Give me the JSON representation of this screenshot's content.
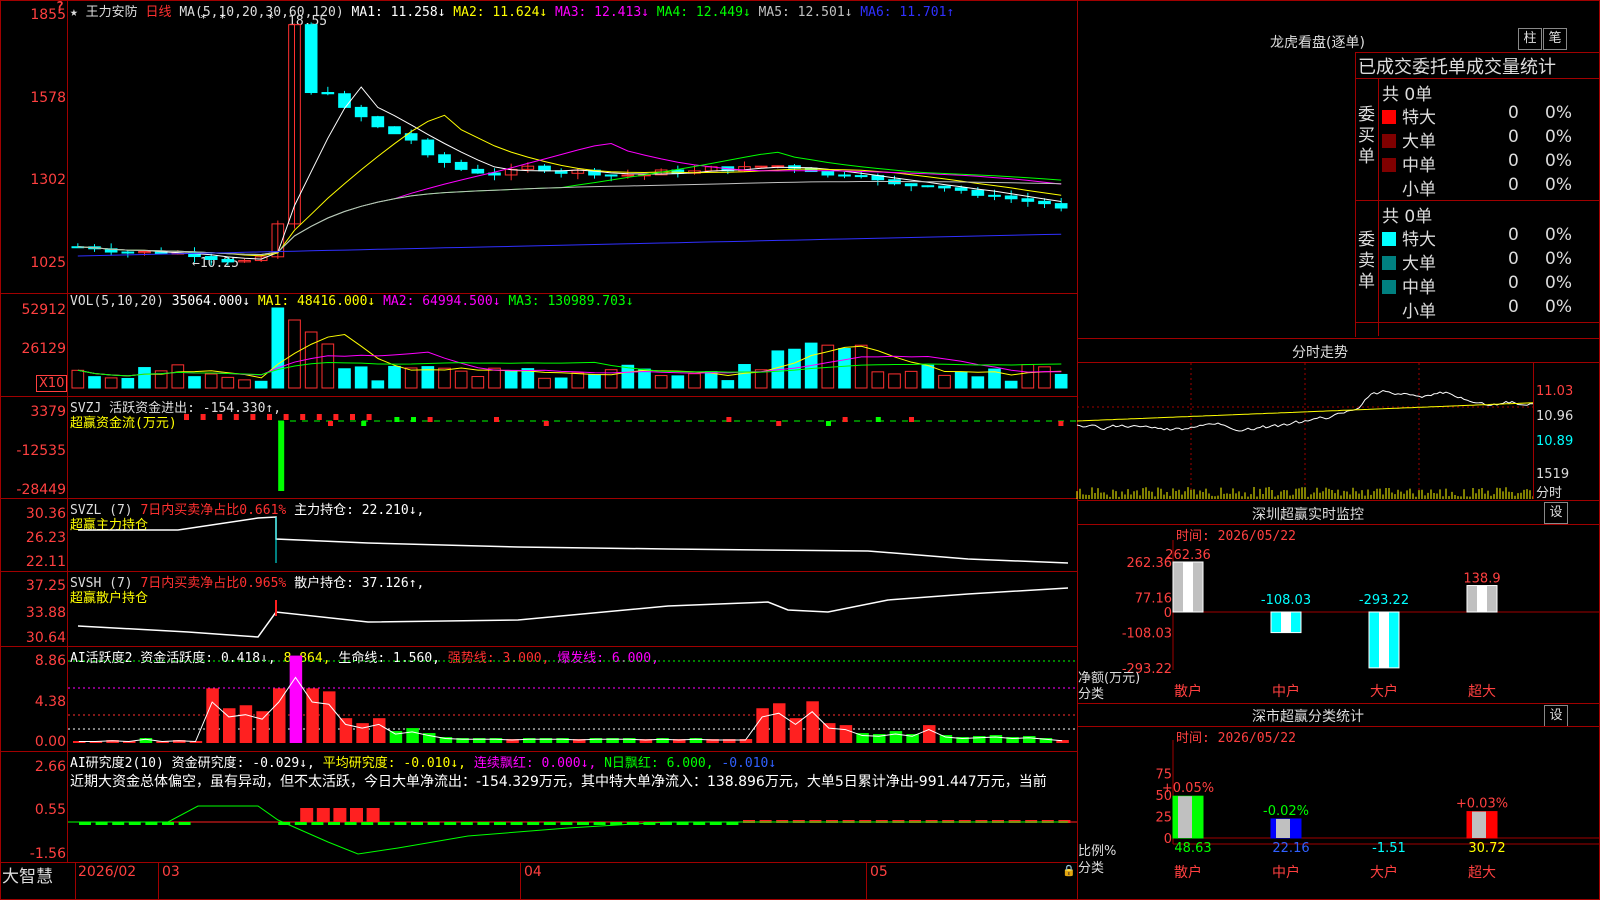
{
  "main": {
    "stock_name": "王力安防",
    "period": "日线",
    "ma_header": "MA(5,10,20,30,60,120)",
    "ma": [
      {
        "label": "MA1: 11.258↓",
        "color": "#ffffff"
      },
      {
        "label": "MA2: 11.624↓",
        "color": "#ffff00"
      },
      {
        "label": "MA3: 12.413↓",
        "color": "#ff00ff"
      },
      {
        "label": "MA4: 12.449↓",
        "color": "#00ff00"
      },
      {
        "label": "MA5: 12.501↓",
        "color": "#c0c0c0"
      },
      {
        "label": "MA6: 11.701↑",
        "color": "#3030ff"
      }
    ],
    "y_ticks": [
      "1855",
      "1578",
      "1302",
      "1025"
    ],
    "high_label": "18.55",
    "low_label": "←10.25",
    "question": "?"
  },
  "vol": {
    "header": "VOL(5,10,20)",
    "value": "35064.000↓",
    "ma": [
      {
        "label": "MA1: 48416.000↓",
        "color": "#ffff00"
      },
      {
        "label": "MA2: 64994.500↓",
        "color": "#ff00ff"
      },
      {
        "label": "MA3: 130989.703↓",
        "color": "#00ff00"
      }
    ],
    "y_ticks": [
      "52912",
      "26129"
    ],
    "unit": "X10"
  },
  "svzj": {
    "line1": "SVZJ  活跃资金进出: -154.330↑,",
    "line2": "超赢资金流(万元)",
    "y_ticks": [
      "3379",
      "-12535",
      "-28449"
    ]
  },
  "svzl": {
    "label_a": "SVZL (7)",
    "label_b": "7日内买卖净占比0.661%",
    "label_c": "主力持仓: 22.210↓,",
    "line2": "超赢主力持仓",
    "y_ticks": [
      "30.36",
      "26.23",
      "22.11"
    ]
  },
  "svsh": {
    "label_a": "SVSH (7)",
    "label_b": "7日内买卖净占比0.965%",
    "label_c": "散户持仓: 37.126↑,",
    "line2": "超赢散户持仓",
    "y_ticks": [
      "37.25",
      "33.88",
      "30.64"
    ]
  },
  "ai_act": {
    "label_a": "AI活跃度2 资金活跃度: 0.418↓,",
    "label_b": "8.864,",
    "label_c": "生命线: 1.560,",
    "label_d": "强势线: 3.000,",
    "label_e": "爆发线: 6.000,",
    "y_ticks": [
      "8.86",
      "4.38",
      "0.00"
    ]
  },
  "ai_res": {
    "label_a": "AI研究度2(10) 资金研究度: -0.029↓,",
    "label_b": "平均研究度: -0.010↓,",
    "label_c": "连续飘红: 0.000↓,",
    "label_d": "N日飘红: 6.000,",
    "label_e": "-0.010↓",
    "commentary": "近期大资金总体偏空，虽有异动，但不太活跃，今日大单净流出：-154.329万元，其中特大单净流入：138.896万元，大单5日累计净出-991.447万元，当前",
    "y_ticks": [
      "2.66",
      "0.55",
      "-1.56"
    ]
  },
  "footer": {
    "brand": "大智慧",
    "dates": [
      "2026/02",
      "03",
      "04",
      "05"
    ]
  },
  "right": {
    "lhb_title": "龙虎看盘(逐单)",
    "btn_zhu": "柱",
    "btn_bi": "笔",
    "stat_title": "已成交委托单成交量统计",
    "buy": {
      "side_label": "委买单",
      "total": "共 0单",
      "rows": [
        {
          "label": "特大",
          "count": "0",
          "pct": "0%",
          "color": "#ff0000"
        },
        {
          "label": "大单",
          "count": "0",
          "pct": "0%",
          "color": "#800000"
        },
        {
          "label": "中单",
          "count": "0",
          "pct": "0%",
          "color": "#800000"
        },
        {
          "label": "小单",
          "count": "0",
          "pct": "0%",
          "color": "#000000"
        }
      ]
    },
    "sell": {
      "side_label": "委卖单",
      "total": "共 0单",
      "rows": [
        {
          "label": "特大",
          "count": "0",
          "pct": "0%",
          "color": "#00ffff"
        },
        {
          "label": "大单",
          "count": "0",
          "pct": "0%",
          "color": "#008080"
        },
        {
          "label": "中单",
          "count": "0",
          "pct": "0%",
          "color": "#008080"
        },
        {
          "label": "小单",
          "count": "0",
          "pct": "0%",
          "color": "#000000"
        }
      ]
    },
    "intraday": {
      "title": "分时走势",
      "price_ticks": [
        "11.03",
        "10.96",
        "10.89"
      ],
      "vol_tick": "1519",
      "vol_unit": "分时"
    },
    "monitor": {
      "title": "深圳超赢实时监控",
      "btn": "设",
      "time": "时间: 2026/05/22",
      "y_ticks": [
        "262.36",
        "77.16",
        "0",
        "-108.03",
        "-293.22"
      ],
      "unit_a": "净额(万元)",
      "unit_b": "分类",
      "bars": [
        {
          "cat": "散户",
          "value": 262.36,
          "label": "262.36",
          "label_color": "#ff4040"
        },
        {
          "cat": "中户",
          "value": -108.03,
          "label": "-108.03",
          "label_color": "#00ffff"
        },
        {
          "cat": "大户",
          "value": -293.22,
          "label": "-293.22",
          "label_color": "#00ffff"
        },
        {
          "cat": "超大",
          "value": 138.9,
          "label": "138.9",
          "label_color": "#ff4040"
        }
      ]
    },
    "classify": {
      "title": "深市超赢分类统计",
      "btn": "设",
      "time": "时间: 2026/05/22",
      "y_ticks": [
        "75",
        "50",
        "25",
        "0"
      ],
      "unit_a": "比例%",
      "unit_b": "分类",
      "bars": [
        {
          "cat": "散户",
          "value": 48.63,
          "value_label": "48.63",
          "delta": "+0.05%",
          "delta_color": "#ff4040",
          "color": "#00ff00",
          "val_color": "#00ff00"
        },
        {
          "cat": "中户",
          "value": 22.16,
          "value_label": "22.16",
          "delta": "-0.02%",
          "delta_color": "#00ff00",
          "color": "#0000ff",
          "val_color": "#3060ff"
        },
        {
          "cat": "大户",
          "value": 0,
          "value_label": "-1.51",
          "delta": "",
          "delta_color": "#00ffff",
          "color": "#00ffff",
          "val_color": "#00ffff"
        },
        {
          "cat": "超大",
          "value": 30.72,
          "value_label": "30.72",
          "delta": "+0.03%",
          "delta_color": "#ff4040",
          "color": "#ff0000",
          "val_color": "#ffff00"
        }
      ]
    }
  }
}
